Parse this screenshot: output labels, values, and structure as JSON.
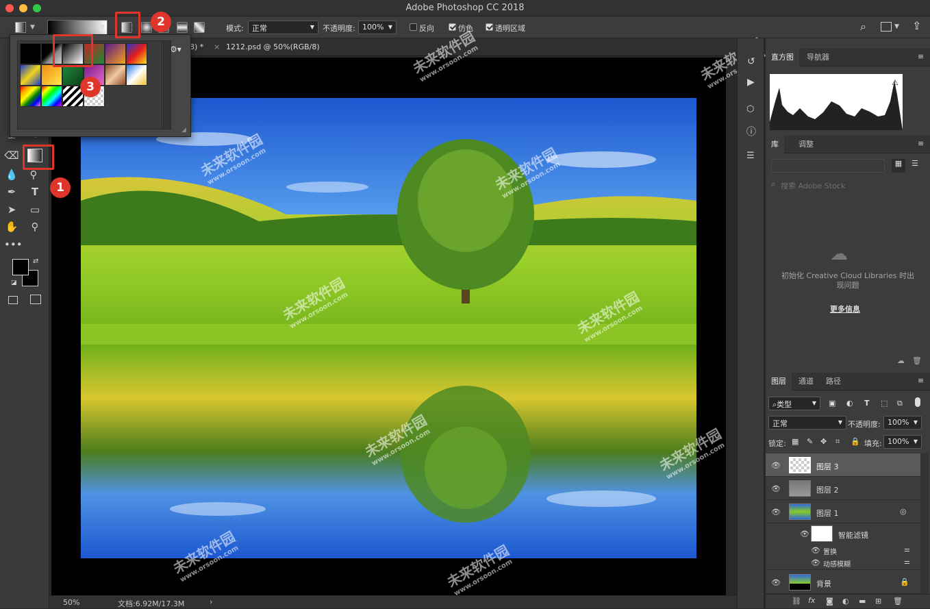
{
  "window": {
    "title": "Adobe Photoshop CC 2018"
  },
  "options_bar": {
    "mode_label": "模式:",
    "mode_value": "正常",
    "opacity_label": "不透明度:",
    "opacity_value": "100%",
    "reverse_label": "反向",
    "dither_label": "仿色",
    "transparency_label": "透明区域"
  },
  "doc_tabs": [
    {
      "label": "8) *"
    },
    {
      "label": "1212.psd @ 50%(RGB/8)"
    }
  ],
  "status": {
    "zoom": "50%",
    "doc_size": "文档:6.92M/17.3M"
  },
  "histogram_panel": {
    "tabs": [
      "直方图",
      "导航器"
    ]
  },
  "library_panel": {
    "tabs": [
      "库",
      "调整"
    ],
    "search_placeholder": "搜索 Adobe Stock",
    "message": "初始化 Creative Cloud Libraries 时出现问题",
    "more_info": "更多信息"
  },
  "layers_panel": {
    "tabs": [
      "图层",
      "通道",
      "路径"
    ],
    "filter_kind": "类型",
    "blend_mode": "正常",
    "opacity_label": "不透明度:",
    "opacity_value": "100%",
    "lock_label": "锁定:",
    "fill_label": "填充:",
    "fill_value": "100%",
    "layers": [
      {
        "name": "图层 3"
      },
      {
        "name": "图层 2"
      },
      {
        "name": "图层 1"
      },
      {
        "name": "智能滤镜"
      },
      {
        "name": "置换"
      },
      {
        "name": "动感模糊"
      },
      {
        "name": "背景"
      }
    ]
  },
  "annotations": [
    "1",
    "2",
    "3"
  ],
  "watermark": {
    "text": "未来软件园",
    "url": "www.orsoon.com"
  },
  "colors": {
    "accent_red": "#e0352b",
    "sky": "#1f63d8",
    "grass": "#7fbf1a"
  }
}
